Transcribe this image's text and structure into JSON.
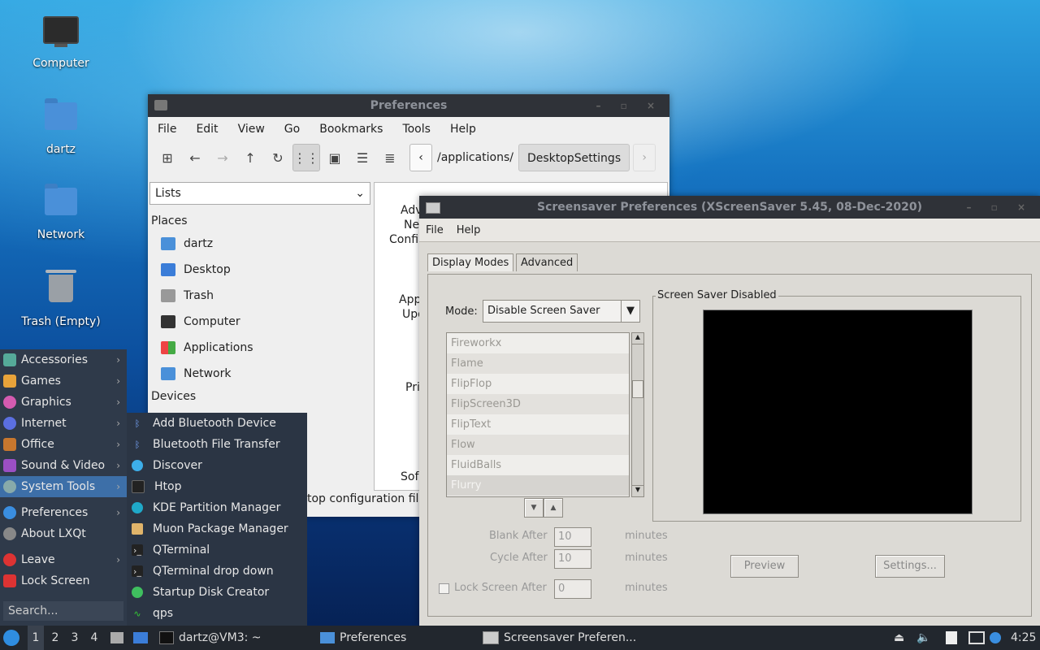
{
  "desktop": {
    "icons": [
      {
        "label": "Computer"
      },
      {
        "label": "dartz"
      },
      {
        "label": "Network"
      },
      {
        "label": "Trash (Empty)"
      }
    ]
  },
  "fm": {
    "title": "Preferences",
    "menu": [
      "File",
      "Edit",
      "View",
      "Go",
      "Bookmarks",
      "Tools",
      "Help"
    ],
    "path": [
      "/applications/",
      "DesktopSettings"
    ],
    "side_select": "Lists",
    "places_label": "Places",
    "places": [
      "dartz",
      "Desktop",
      "Trash",
      "Computer",
      "Applications",
      "Network"
    ],
    "devices_label": "Devices",
    "content_fragments": [
      "Adv",
      "Ne",
      "Confi",
      "App",
      "Upd",
      "Pri",
      "Sof"
    ],
    "status": "top configuration fil"
  },
  "xs": {
    "title": "Screensaver Preferences  (XScreenSaver 5.45, 08-Dec-2020)",
    "menu": [
      "File",
      "Help"
    ],
    "tabs": [
      "Display Modes",
      "Advanced"
    ],
    "mode_label": "Mode:",
    "mode_value": "Disable Screen Saver",
    "list": [
      "Fireworkx",
      "Flame",
      "FlipFlop",
      "FlipScreen3D",
      "FlipText",
      "Flow",
      "FluidBalls",
      "Flurry"
    ],
    "preview_frame_label": "Screen Saver Disabled",
    "blank_after_label": "Blank After",
    "blank_after_value": "10",
    "cycle_after_label": "Cycle After",
    "cycle_after_value": "10",
    "lock_label": "Lock Screen After",
    "lock_value": "0",
    "minutes": "minutes",
    "preview_btn": "Preview",
    "settings_btn": "Settings..."
  },
  "startmenu": {
    "items": [
      "Accessories",
      "Games",
      "Graphics",
      "Internet",
      "Office",
      "Sound & Video",
      "System Tools",
      "Preferences",
      "About LXQt",
      "Leave",
      "Lock Screen"
    ],
    "search_placeholder": "Search...",
    "submenu": [
      "Add Bluetooth Device",
      "Bluetooth File Transfer",
      "Discover",
      "Htop",
      "KDE Partition Manager",
      "Muon Package Manager",
      "QTerminal",
      "QTerminal drop down",
      "Startup Disk Creator",
      "qps"
    ]
  },
  "taskbar": {
    "workspaces": [
      "1",
      "2",
      "3",
      "4"
    ],
    "tasks": [
      "dartz@VM3: ~",
      "Preferences",
      "Screensaver Preferen..."
    ],
    "clock": "4:25"
  },
  "colors": {
    "accent": "#3d6fa8",
    "panel": "#22272e",
    "titlebar": "#2f3238"
  }
}
